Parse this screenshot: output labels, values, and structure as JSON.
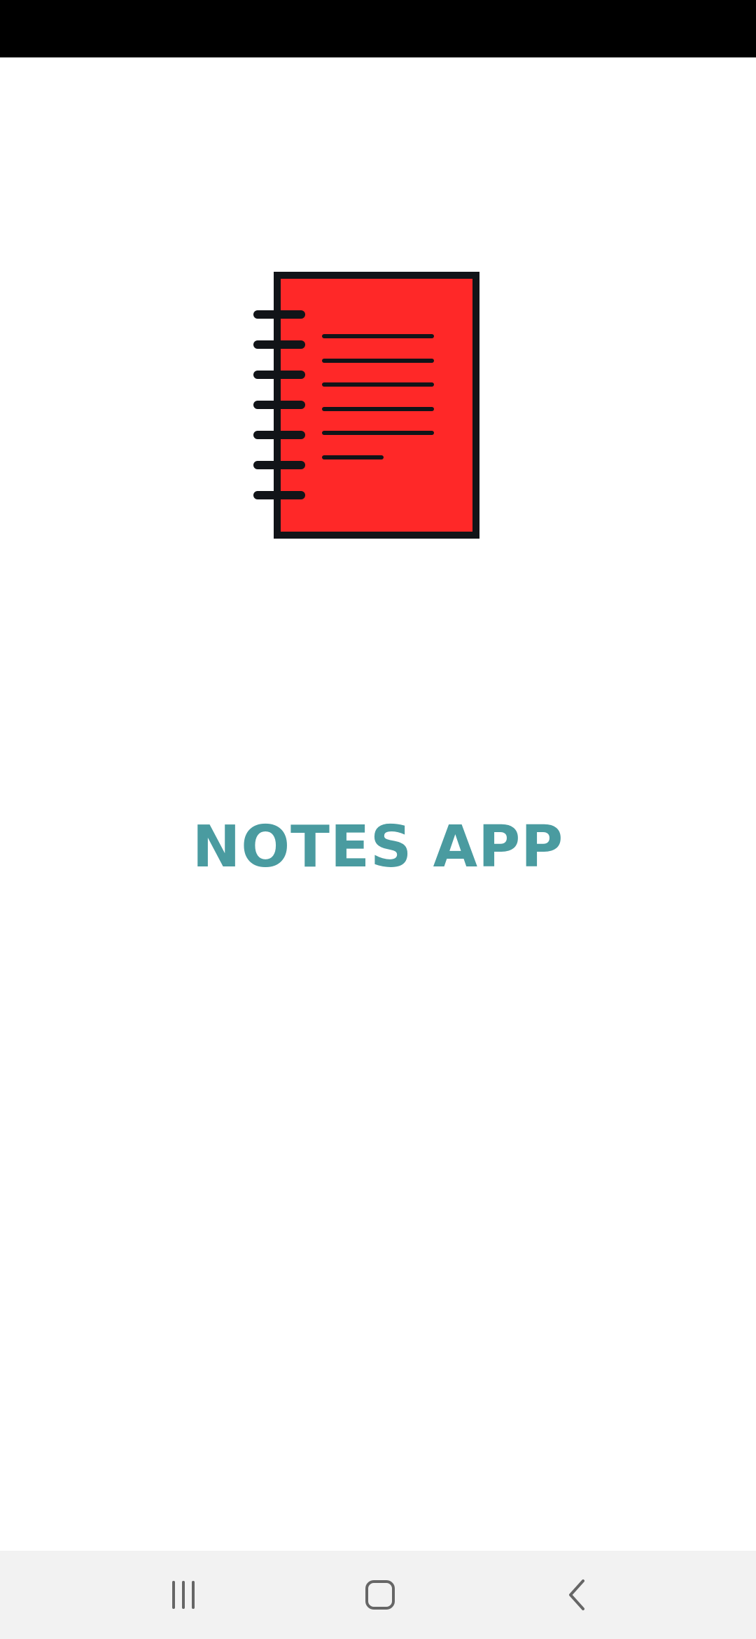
{
  "app": {
    "title": "NOTES APP",
    "logo_icon": "spiral-notebook-icon",
    "title_color": "#4a9ba0",
    "logo_color": "#ff2828"
  },
  "navigation_bar": {
    "recents_icon": "recent-apps-icon",
    "home_icon": "home-icon",
    "back_icon": "back-icon"
  }
}
